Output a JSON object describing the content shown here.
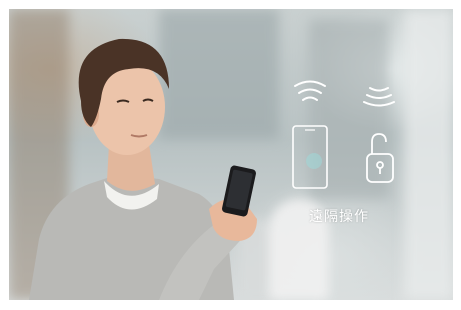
{
  "overlay": {
    "caption": "遠隔操作",
    "icons": [
      "wifi-signal-icon",
      "wifi-signal-icon",
      "smartphone-icon",
      "unlocked-padlock-icon"
    ],
    "icon_color": "#ffffff"
  }
}
